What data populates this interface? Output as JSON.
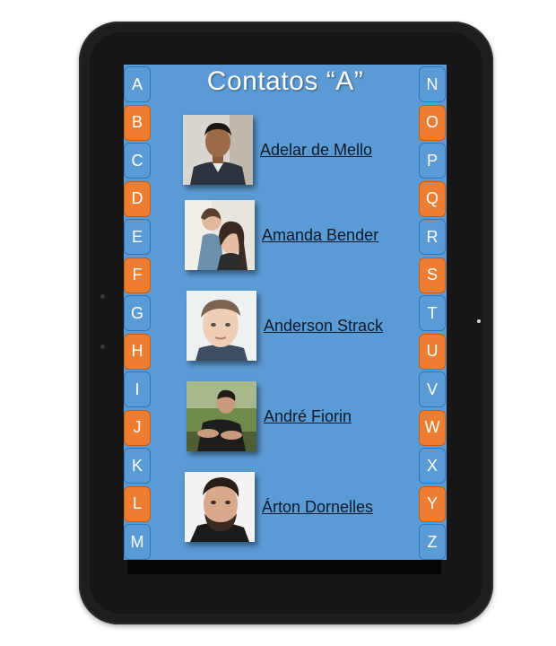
{
  "title": "Contatos “A”",
  "tabs_left": [
    {
      "letter": "A",
      "color": "blue"
    },
    {
      "letter": "B",
      "color": "orange"
    },
    {
      "letter": "C",
      "color": "blue"
    },
    {
      "letter": "D",
      "color": "orange"
    },
    {
      "letter": "E",
      "color": "blue"
    },
    {
      "letter": "F",
      "color": "orange"
    },
    {
      "letter": "G",
      "color": "blue"
    },
    {
      "letter": "H",
      "color": "orange"
    },
    {
      "letter": "I",
      "color": "blue"
    },
    {
      "letter": "J",
      "color": "orange"
    },
    {
      "letter": "K",
      "color": "blue"
    },
    {
      "letter": "L",
      "color": "orange"
    },
    {
      "letter": "M",
      "color": "blue"
    }
  ],
  "tabs_right": [
    {
      "letter": "N",
      "color": "blue"
    },
    {
      "letter": "O",
      "color": "orange"
    },
    {
      "letter": "P",
      "color": "blue"
    },
    {
      "letter": "Q",
      "color": "orange"
    },
    {
      "letter": "R",
      "color": "blue"
    },
    {
      "letter": "S",
      "color": "orange"
    },
    {
      "letter": "T",
      "color": "blue"
    },
    {
      "letter": "U",
      "color": "orange"
    },
    {
      "letter": "V",
      "color": "blue"
    },
    {
      "letter": "W",
      "color": "orange"
    },
    {
      "letter": "X",
      "color": "blue"
    },
    {
      "letter": "Y",
      "color": "orange"
    },
    {
      "letter": "Z",
      "color": "blue"
    }
  ],
  "contacts": [
    {
      "name": "Adelar de Mello",
      "photo": "contact-photo"
    },
    {
      "name": "Amanda Bender",
      "photo": "contact-photo"
    },
    {
      "name": "Anderson Strack",
      "photo": "contact-photo"
    },
    {
      "name": "André Fiorin",
      "photo": "contact-photo"
    },
    {
      "name": "Árton Dornelles",
      "photo": "contact-photo"
    }
  ],
  "colors": {
    "screen": "#5b9bd5",
    "tab_blue": "#5b9bd5",
    "tab_orange": "#ed7d31",
    "device": "#1e1e1e"
  }
}
